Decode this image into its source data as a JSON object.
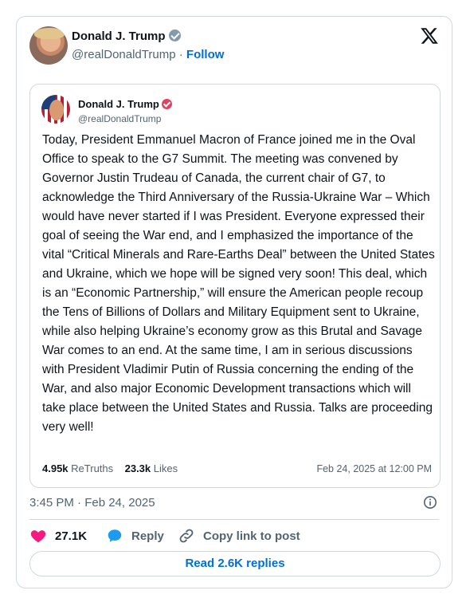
{
  "post": {
    "author_name": "Donald J. Trump",
    "handle": "@realDonaldTrump",
    "separator": " · ",
    "follow_label": "Follow",
    "timestamp": "3:45 PM · Feb 24, 2025"
  },
  "quote": {
    "author_name": "Donald J. Trump",
    "handle": "@realDonaldTrump",
    "body": "Today, President Emmanuel Macron of France joined me in the Oval Office to speak to the G7 Summit. The meeting was convened by Governor Justin Trudeau of Canada, the current chair of G7, to acknowledge the Third Anniversary of the Russia-Ukraine War – Which would have never started if I was President. Everyone expressed their goal of seeing the War end, and I emphasized the importance of the vital “Critical Minerals and Rare-Earths Deal” between the United States and Ukraine, which we hope will be signed very soon! This deal, which is an “Economic Partnership,” will ensure the American people recoup the Tens of Billions of Dollars and Military Equipment sent to Ukraine, while also helping Ukraine’s economy grow as this Brutal and Savage War comes to an end. At the same time, I am in serious discussions with President Vladimir Putin of Russia concerning the ending of the War, and also major Economic Development transactions which will take place between the United States and Russia. Talks are proceeding very well!",
    "retruths_count": "4.95k",
    "retruths_label": "ReTruths",
    "likes_count": "23.3k",
    "likes_label": "Likes",
    "date": "Feb 24, 2025 at 12:00 PM"
  },
  "actions": {
    "like_count": "27.1K",
    "reply_label": "Reply",
    "copy_label": "Copy link to post",
    "read_replies_label": "Read 2.6K replies"
  },
  "colors": {
    "link": "#006fd6",
    "like": "#f91880",
    "reply": "#1d9bf0",
    "border": "#cfd9de",
    "muted": "#536471"
  },
  "icons": {
    "x": "x-logo-icon",
    "verified": "verified-badge-icon",
    "info": "info-icon",
    "heart": "heart-icon",
    "reply": "speech-bubble-icon",
    "link": "link-icon"
  }
}
